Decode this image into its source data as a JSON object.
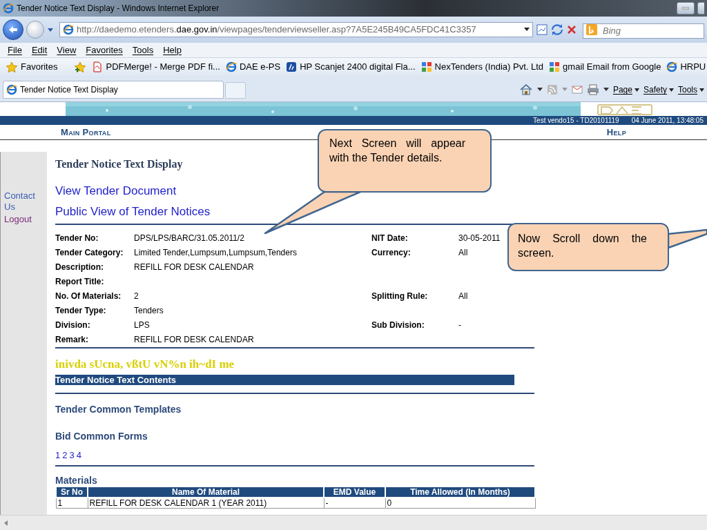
{
  "window": {
    "title": "Tender Notice Text Display - Windows Internet Explorer"
  },
  "address_bar": {
    "url_prefix": "http://daedemo.etenders.",
    "url_domain": "dae.gov.in",
    "url_rest": "/viewpages/tenderviewseller.asp?7A5E245B49CA5FDC41C3357",
    "search_placeholder": "Bing"
  },
  "menu": [
    "File",
    "Edit",
    "View",
    "Favorites",
    "Tools",
    "Help"
  ],
  "favorites_bar": {
    "label": "Favorites",
    "links": [
      {
        "kind": "pdf",
        "label": "PDFMerge! - Merge PDF fi..."
      },
      {
        "kind": "ie",
        "label": "DAE e-PS"
      },
      {
        "kind": "hp",
        "label": "HP Scanjet 2400 digital Fla..."
      },
      {
        "kind": "tiles",
        "label": "NexTenders (India) Pvt. Ltd"
      },
      {
        "kind": "tiles",
        "label": "gmail Email from Google"
      },
      {
        "kind": "ie",
        "label": "HRPU"
      }
    ]
  },
  "tab": {
    "label": "Tender Notice Text Display"
  },
  "command_bar": [
    "Page",
    "Safety",
    "Tools"
  ],
  "header": {
    "user": "Test vendo15 - TD20101119",
    "datetime": "04 June 2011, 13:48:05",
    "nav": [
      "Main Portal",
      "Help"
    ]
  },
  "sidebar": {
    "items": [
      "Contact Us",
      "Logout"
    ]
  },
  "page": {
    "title": "Tender Notice Text Display",
    "links": [
      "View Tender Document",
      "Public View of Tender Notices"
    ],
    "details": [
      {
        "label": "Tender No:",
        "value": "DPS/LPS/BARC/31.05.2011/2",
        "label2": "NIT Date:",
        "value2": "30-05-2011"
      },
      {
        "label": "Tender Category:",
        "value": "Limited Tender,Lumpsum,Lumpsum,Tenders",
        "label2": "Currency:",
        "value2": "All"
      },
      {
        "label": "Description:",
        "value": "REFILL FOR DESK CALENDAR"
      },
      {
        "label": "Report Title:"
      },
      {
        "label": "No. Of Materials:",
        "value": "2",
        "label2": "Splitting Rule:",
        "value2": "All"
      },
      {
        "label": "Tender Type:",
        "value": "Tenders"
      },
      {
        "label": "Division:",
        "value": "LPS",
        "label2": "Sub Division:",
        "value2": "-"
      },
      {
        "label": "Remark:",
        "value": "REFILL FOR DESK CALENDAR"
      }
    ],
    "hindi_title": "inivda sUcna, vßtU vN%n ih~dI me",
    "contents_bar": "Tender Notice Text Contents",
    "templates_heading": "Tender Common Templates",
    "forms_heading": "Bid Common Forms",
    "form_links": [
      "1",
      "2",
      "3",
      "4"
    ],
    "materials_heading": "Materials",
    "table": {
      "columns": [
        "Sr No",
        "Name Of Material",
        "EMD Value",
        "Time Allowed (In Months)"
      ],
      "rows": [
        [
          "1",
          "REFILL FOR DESK CALENDAR 1 (YEAR 2011)",
          "-",
          "0"
        ]
      ]
    }
  },
  "callouts": [
    {
      "text": "Next Screen will appear with the Tender details."
    },
    {
      "text": "Now Scroll down the screen."
    }
  ]
}
